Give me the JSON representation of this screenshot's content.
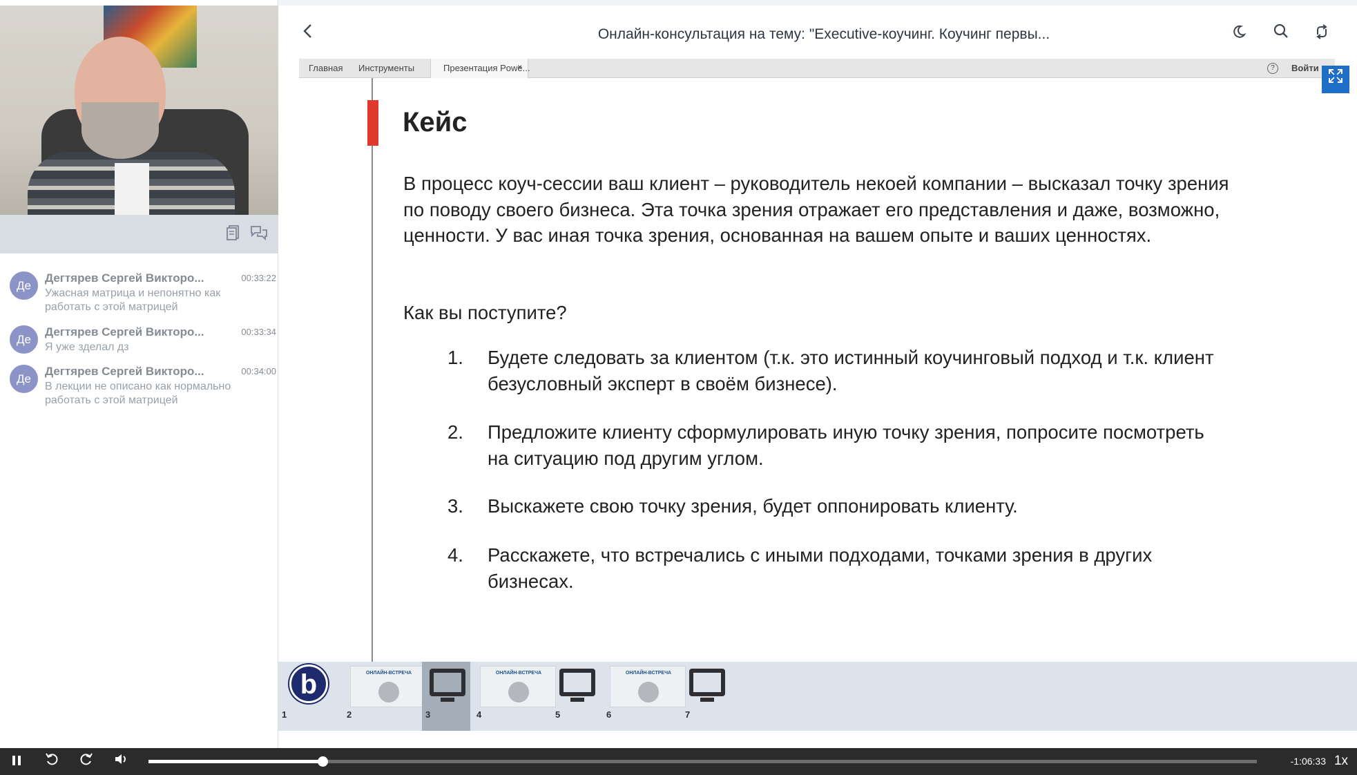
{
  "window": {
    "title": "Онлайн-консультация на тему: \"Executive-коучинг. Коучинг первы..."
  },
  "chat": {
    "messages": [
      {
        "initials": "Де",
        "author": "Дегтярев Сергей Викторо...",
        "time": "00:33:22",
        "text": "Ужасная матрица и непонятно как работать с этой матрицей"
      },
      {
        "initials": "Де",
        "author": "Дегтярев Сергей Викторо...",
        "time": "00:33:34",
        "text": "Я уже зделал дз"
      },
      {
        "initials": "Де",
        "author": "Дегтярев Сергей Викторо...",
        "time": "00:34:00",
        "text": "В лекции не описано как нормально работать с этой матрицей"
      }
    ]
  },
  "presentation": {
    "tabs": [
      "Главная",
      "Инструменты",
      "Презентация Powe..."
    ],
    "close_glyph": "×",
    "login_label": "Войти",
    "help_glyph": "?",
    "heading": "Кейс",
    "paragraph": "В процесс коуч-сессии ваш клиент – руководитель некоей компании – высказал точку зрения по поводу своего бизнеса. Эта точка зрения отражает его представления и даже, возможно, ценности. У вас иная точка зрения, основанная на вашем опыте и ваших ценностях.",
    "question": "Как вы поступите?",
    "options": [
      {
        "num": "1.",
        "text": "Будете следовать за клиентом (т.к. это истинный коучинговый подход и т.к. клиент безусловный эксперт в своём бизнесе)."
      },
      {
        "num": "2.",
        "text": "Предложите клиенту сформулировать иную точку зрения, попросите посмотреть на ситуацию под другим углом."
      },
      {
        "num": "3.",
        "text": "Выскажете свою точку зрения, будет оппонировать клиенту."
      },
      {
        "num": "4.",
        "text": "Расскажете, что встречались с иными подходами, точками зрения в других бизнесах."
      }
    ]
  },
  "thumbnails": [
    {
      "num": "1",
      "kind": "logo",
      "logo_letter": "b"
    },
    {
      "num": "2",
      "kind": "image",
      "caption": "ОНЛАЙН-ВСТРЕЧА"
    },
    {
      "num": "3",
      "kind": "screen",
      "active": true
    },
    {
      "num": "4",
      "kind": "image",
      "caption": "ОНЛАЙН-ВСТРЕЧА"
    },
    {
      "num": "5",
      "kind": "screen"
    },
    {
      "num": "6",
      "kind": "image",
      "caption": "ОНЛАЙН-ВСТРЕЧА"
    },
    {
      "num": "7",
      "kind": "screen"
    }
  ],
  "player": {
    "progress_fraction": 0.157,
    "remaining_time": "-1:06:33",
    "speed": "1x"
  },
  "icons": {
    "back": "back-chevron-icon",
    "theme": "moon-icon",
    "search": "search-icon",
    "swap": "swap-layout-icon",
    "notes": "notes-icon",
    "chat": "chat-icon",
    "expand": "expand-icon",
    "play_pause": "pause-icon",
    "rewind": "rewind-icon",
    "forward": "forward-icon",
    "volume": "volume-icon"
  },
  "colors": {
    "accent_blue": "#1f6ec8",
    "slide_red": "#e03a2e",
    "avatar": "#8b93c7"
  }
}
